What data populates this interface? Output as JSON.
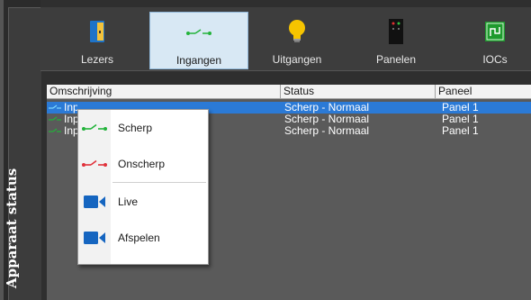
{
  "side_panel": {
    "title": "Apparaat status"
  },
  "toolbar": {
    "items": [
      {
        "label": "Lezers",
        "icon": "door-icon"
      },
      {
        "label": "Ingangen",
        "icon": "input-icon",
        "selected": true
      },
      {
        "label": "Uitgangen",
        "icon": "lightbulb-icon"
      },
      {
        "label": "Panelen",
        "icon": "panel-icon"
      },
      {
        "label": "IOCs",
        "icon": "ioc-icon"
      }
    ]
  },
  "grid": {
    "columns": [
      "Omschrijving",
      "Status",
      "Paneel"
    ],
    "rows": [
      {
        "name": "Input 1",
        "status": "Scherp - Normaal",
        "panel": "Panel 1",
        "selected": true
      },
      {
        "name": "Input 2",
        "status": "Scherp - Normaal",
        "panel": "Panel 1",
        "selected": false
      },
      {
        "name": "Input 3",
        "status": "Scherp - Normaal",
        "panel": "Panel 1",
        "selected": false
      }
    ],
    "visible_row_prefix": [
      "Inp",
      "Inp",
      "Inp",
      "Inp"
    ]
  },
  "context_menu": {
    "items": [
      {
        "label": "Scherp",
        "icon": "armed-input-icon"
      },
      {
        "label": "Onscherp",
        "icon": "disarmed-input-icon"
      },
      {
        "label": "Live",
        "icon": "video-camera-icon"
      },
      {
        "label": "Afspelen",
        "icon": "video-camera-playback-icon"
      }
    ]
  },
  "colors": {
    "background": "#2f2f2f",
    "selection": "#2b7ad6",
    "armed_green": "#22b33a",
    "disarmed_red": "#e0313a",
    "camera_blue": "#1565c0"
  }
}
